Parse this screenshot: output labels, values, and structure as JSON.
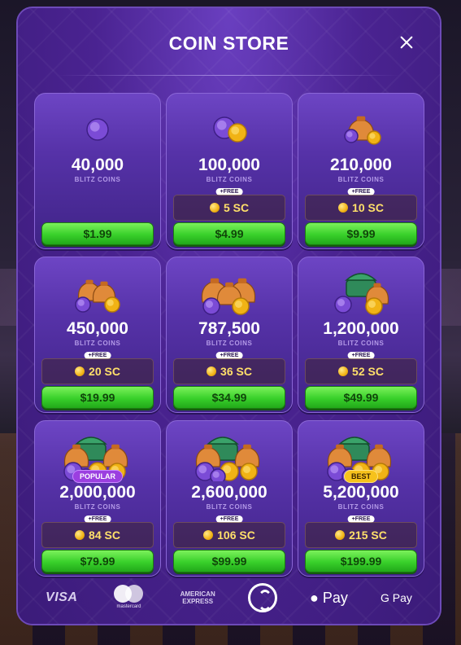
{
  "header": {
    "title": "COIN STORE",
    "close_icon": "close-icon"
  },
  "coin_label": "BLITZ COINS",
  "free_label": "+FREE",
  "packages": [
    {
      "amount": "40,000",
      "sc": "",
      "price": "$1.99",
      "badge": "",
      "art": "coin-single-icon"
    },
    {
      "amount": "100,000",
      "sc": "5 SC",
      "price": "$4.99",
      "badge": "",
      "art": "coin-pair-icon"
    },
    {
      "amount": "210,000",
      "sc": "10 SC",
      "price": "$9.99",
      "badge": "",
      "art": "coin-bag-small-icon"
    },
    {
      "amount": "450,000",
      "sc": "20 SC",
      "price": "$19.99",
      "badge": "",
      "art": "coin-bags-icon"
    },
    {
      "amount": "787,500",
      "sc": "36 SC",
      "price": "$34.99",
      "badge": "",
      "art": "coin-bags-large-icon"
    },
    {
      "amount": "1,200,000",
      "sc": "52 SC",
      "price": "$49.99",
      "badge": "",
      "art": "coin-chest-icon"
    },
    {
      "amount": "2,000,000",
      "sc": "84 SC",
      "price": "$79.99",
      "badge": "POPULAR",
      "art": "coin-treasure-icon"
    },
    {
      "amount": "2,600,000",
      "sc": "106 SC",
      "price": "$99.99",
      "badge": "",
      "art": "coin-treasure-large-icon"
    },
    {
      "amount": "5,200,000",
      "sc": "215 SC",
      "price": "$199.99",
      "badge": "BEST",
      "art": "coin-treasure-huge-icon"
    }
  ],
  "payments": {
    "visa": "VISA",
    "mastercard": "mastercard",
    "amex_line1": "AMERICAN",
    "amex_line2": "EXPRESS",
    "apple_pay": " Pay",
    "google_pay": "G Pay"
  },
  "colors": {
    "modal": "#4a2391",
    "buy_green": "#38d02a",
    "sc_gold": "#ffe06a",
    "popular": "#9b3fe0",
    "best": "#f6c21c"
  }
}
